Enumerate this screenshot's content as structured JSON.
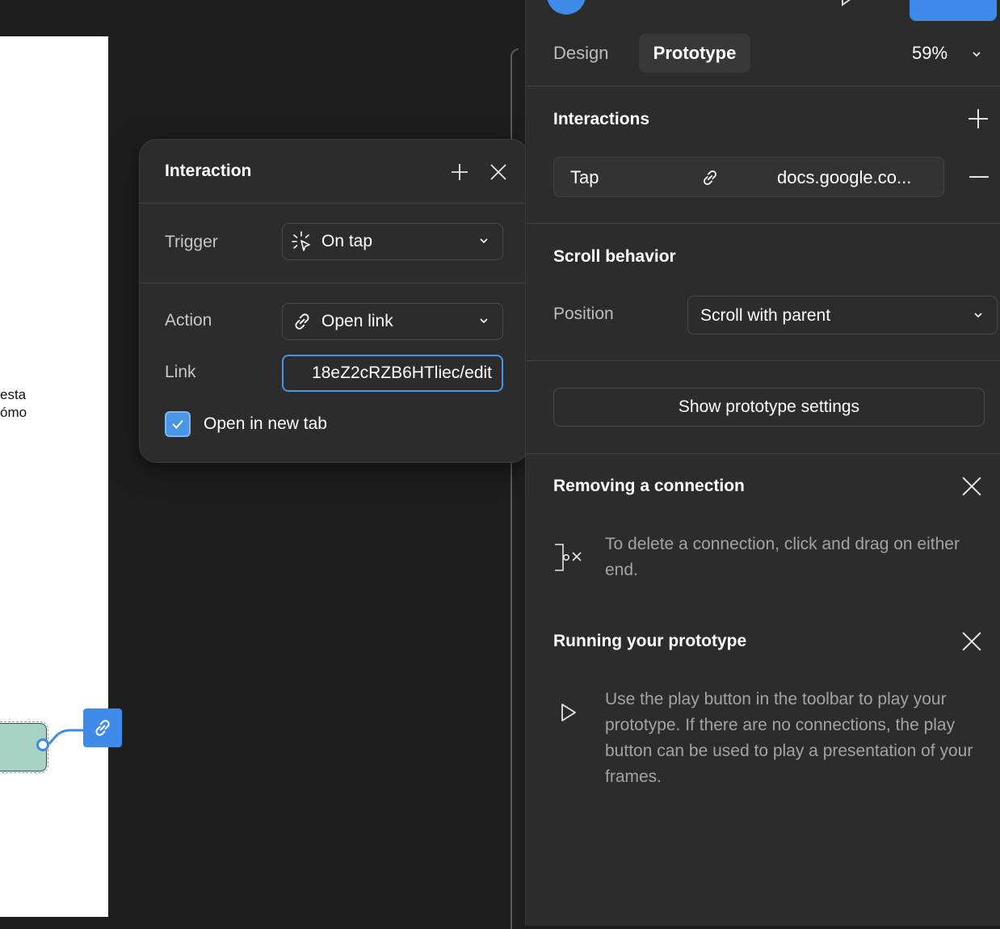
{
  "canvas": {
    "frame_text_lines": [
      "esta",
      "ómo"
    ]
  },
  "popup": {
    "title": "Interaction",
    "trigger_label": "Trigger",
    "trigger_value": "On tap",
    "action_label": "Action",
    "action_value": "Open link",
    "link_label": "Link",
    "link_value": "18eZ2cRZB6HTliec/edit",
    "open_new_tab_label": "Open in new tab",
    "open_new_tab_checked": true
  },
  "panel": {
    "tabs": {
      "design": "Design",
      "prototype": "Prototype"
    },
    "zoom": "59%",
    "interactions": {
      "title": "Interactions",
      "item": {
        "trigger": "Tap",
        "destination": "docs.google.co..."
      }
    },
    "scroll_behavior": {
      "title": "Scroll behavior",
      "position_label": "Position",
      "position_value": "Scroll with parent"
    },
    "show_prototype_settings": "Show prototype settings",
    "tips": {
      "removing": {
        "title": "Removing a connection",
        "text": "To delete a connection, click and drag on either end."
      },
      "running": {
        "title": "Running your prototype",
        "text": "Use the play button in the toolbar to play your prototype. If there are no connections, the play button can be used to play a presentation of your frames."
      }
    }
  },
  "colors": {
    "accent": "#3e8bea",
    "panel_bg": "#2c2c2c",
    "canvas_bg": "#1e1e1e",
    "node_fill": "#a6d1c3"
  }
}
